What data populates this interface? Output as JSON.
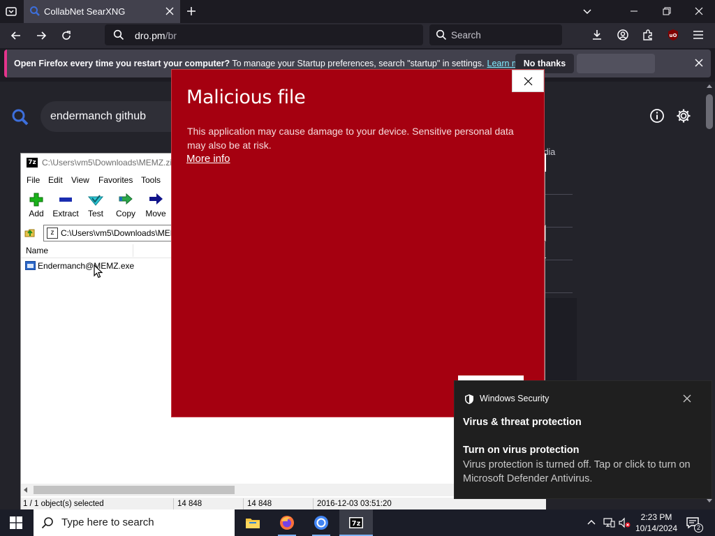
{
  "browser": {
    "tab_title": "CollabNet SearXNG",
    "url_main": "dro.pm",
    "url_path": "/br",
    "search_placeholder": "Search"
  },
  "notification": {
    "bold_text": "Open Firefox every time you restart your computer?",
    "text": " To manage your Startup preferences, search \"startup\" in settings.",
    "learn_more": "Learn more",
    "no_thanks": "No thanks"
  },
  "page": {
    "query": "endermanch github",
    "social_tab": "al Media"
  },
  "sevenzip": {
    "title": "C:\\Users\\vm5\\Downloads\\MEMZ.zip\\",
    "title_icon": "7z",
    "menu": [
      "File",
      "Edit",
      "View",
      "Favorites",
      "Tools"
    ],
    "toolbar": [
      {
        "label": "Add",
        "icon": "plus-icon"
      },
      {
        "label": "Extract",
        "icon": "minus-icon"
      },
      {
        "label": "Test",
        "icon": "check-icon"
      },
      {
        "label": "Copy",
        "icon": "copy-arrow-icon"
      },
      {
        "label": "Move",
        "icon": "move-arrow-icon"
      }
    ],
    "address": "C:\\Users\\vm5\\Downloads\\MEMZ.zip\\",
    "column_name": "Name",
    "file": "Endermanch@MEMZ.exe",
    "status": {
      "selected": "1 / 1 object(s) selected",
      "size": "14 848",
      "packed": "14 848",
      "modified": "2016-12-03 03:51:20"
    }
  },
  "smartscreen": {
    "title": "Malicious file",
    "message": "This application may cause damage to your device. Sensitive personal data may also be at risk.",
    "more_info": "More info",
    "accent": "#a50010"
  },
  "toast": {
    "app": "Windows Security",
    "heading": "Virus & threat protection",
    "title": "Turn on virus protection",
    "body": "Virus protection is turned off. Tap or click to turn on Microsoft Defender Antivirus."
  },
  "taskbar": {
    "search_placeholder": "Type here to search",
    "apps": [
      "file-explorer-icon",
      "firefox-icon",
      "chrome-icon",
      "sevenzip-icon"
    ],
    "time": "2:23 PM",
    "date": "10/14/2024",
    "notification_count": "2"
  }
}
